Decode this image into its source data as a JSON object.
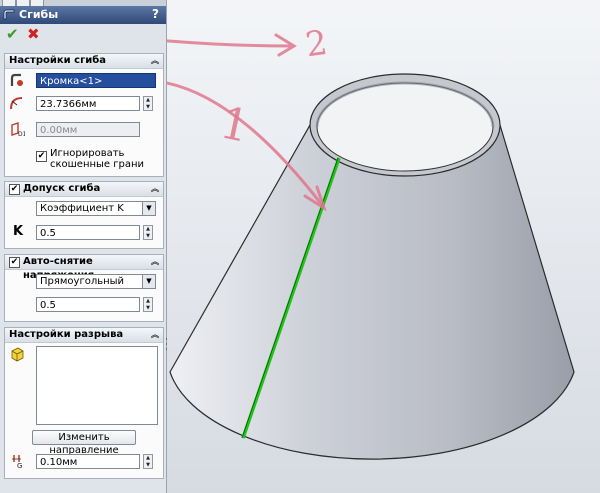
{
  "panel": {
    "title": "Сгибы",
    "help": "?",
    "ok_icon": "check-icon",
    "cancel_icon": "cross-icon"
  },
  "bend_params": {
    "title": "Настройки сгиба",
    "fixed_edge": "Кромка<1>",
    "radius": "23.7366мм",
    "angle": "0.00мм",
    "ignore_bevel_label_1": "Игнорировать",
    "ignore_bevel_label_2": "скошенные грани",
    "ignore_bevel_checked": true
  },
  "bend_allowance": {
    "title": "Допуск сгиба",
    "checked": true,
    "type": "Коэффициент K",
    "k_label": "K",
    "k_value": "0.5"
  },
  "auto_relief": {
    "title": "Авто-снятие напряжения",
    "checked": true,
    "type": "Прямоугольный",
    "value": "0.5"
  },
  "rip_params": {
    "title": "Настройки разрыва",
    "change_direction": "Изменить направление",
    "gap": "0.10мм"
  },
  "annotations": {
    "arrow1_label": "1",
    "arrow2_label": "2",
    "ink_color": "#e0788c"
  },
  "model": {
    "highlight_color": "#22c21a",
    "surface_color": "#c9ccd4"
  }
}
